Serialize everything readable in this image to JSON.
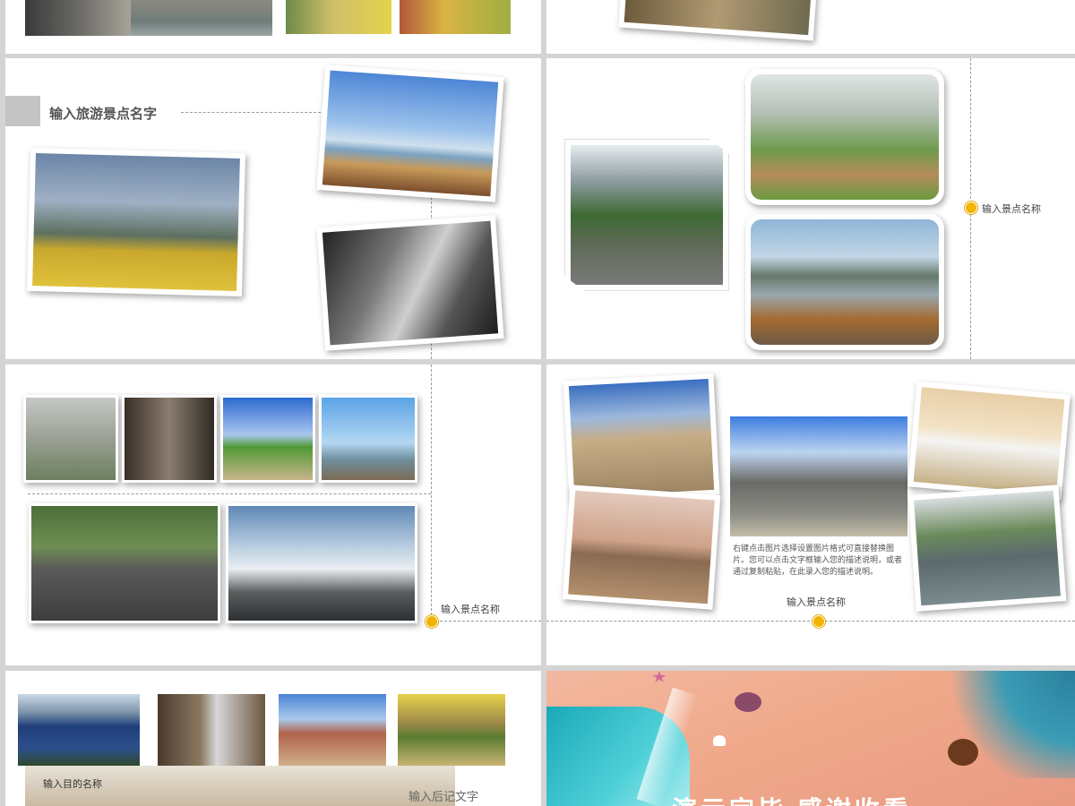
{
  "slide2": {
    "heading": "输入旅游景点名字"
  },
  "slide3": {
    "label": "输入景点名称"
  },
  "slide4": {
    "label": "输入景点名称"
  },
  "slide5": {
    "description": "右键点击图片选择设置图片格式可直接替换图片。您可以点击文字框输入您的描述说明，或者通过复制粘贴，在此录入您的描述说明。",
    "label": "输入景点名称"
  },
  "slide6": {
    "destination": "输入目的名称",
    "note": "输入后记文字"
  },
  "slide7": {
    "banner": "演示完毕 感谢收看"
  },
  "colors": {
    "accent_dot": "#f2b400",
    "heading_block": "#c4c4c4",
    "line": "#9a9a9a"
  }
}
